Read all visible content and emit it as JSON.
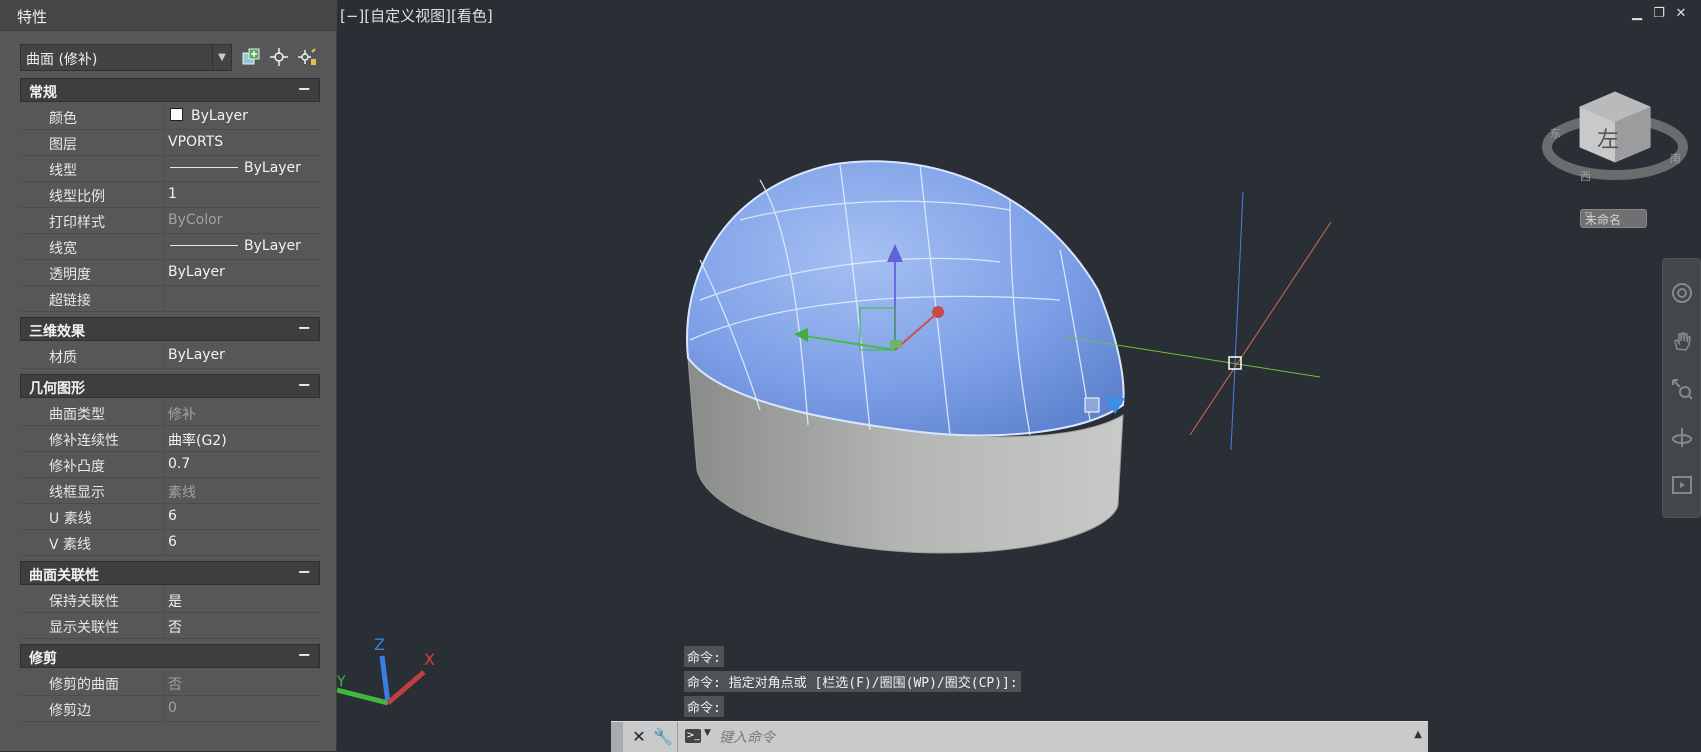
{
  "panel": {
    "title": "特性",
    "selector_value": "曲面 (修补)",
    "sections": [
      {
        "title": "常规",
        "toggle": "−"
      },
      {
        "title": "三维效果",
        "toggle": "−"
      },
      {
        "title": "几何图形",
        "toggle": "−"
      },
      {
        "title": "曲面关联性",
        "toggle": "−"
      },
      {
        "title": "修剪",
        "toggle": "−"
      }
    ],
    "general": [
      {
        "key": "颜色",
        "value": "ByLayer"
      },
      {
        "key": "图层",
        "value": "VPORTS"
      },
      {
        "key": "线型",
        "value": "ByLayer"
      },
      {
        "key": "线型比例",
        "value": "1"
      },
      {
        "key": "打印样式",
        "value": "ByColor"
      },
      {
        "key": "线宽",
        "value": "ByLayer"
      },
      {
        "key": "透明度",
        "value": "ByLayer"
      },
      {
        "key": "超链接",
        "value": ""
      }
    ],
    "effects3d": [
      {
        "key": "材质",
        "value": "ByLayer"
      }
    ],
    "geometry": [
      {
        "key": "曲面类型",
        "value": "修补"
      },
      {
        "key": "修补连续性",
        "value": "曲率(G2)"
      },
      {
        "key": "修补凸度",
        "value": "0.7"
      },
      {
        "key": "线框显示",
        "value": "素线"
      },
      {
        "key": "U 素线",
        "value": "6"
      },
      {
        "key": "V 素线",
        "value": "6"
      }
    ],
    "associativity": [
      {
        "key": "保持关联性",
        "value": "是"
      },
      {
        "key": "显示关联性",
        "value": "否"
      }
    ],
    "trim": [
      {
        "key": "修剪的曲面",
        "value": "否"
      },
      {
        "key": "修剪边",
        "value": "0"
      }
    ]
  },
  "viewport": {
    "label": "[−][自定义视图][看色]",
    "viewcube_face": "左",
    "named_view": "未命名",
    "ucs_labels": {
      "x": "X",
      "y": "Y",
      "z": "Z"
    }
  },
  "command": {
    "history": [
      "命令:",
      "命令: 指定对角点或 [栏选(F)/圈围(WP)/圈交(CP)]:",
      "命令:"
    ],
    "placeholder": "键入命令"
  },
  "colors": {
    "background": "#2a2e35",
    "panel": "#555759",
    "surface_blue": "#7b9ee6",
    "solid_gray": "#a8aaa8"
  }
}
